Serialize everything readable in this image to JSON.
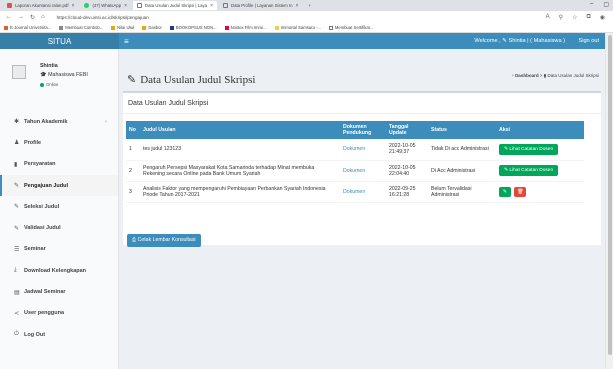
{
  "browser": {
    "tabs": [
      {
        "label": "Laporan Akuntansi ralan.pdf",
        "color": "#d9534f"
      },
      {
        "label": "(47) WhatsApp",
        "color": "#25d366"
      },
      {
        "label": "Data Usulan Judul Skripsi | Laya",
        "color": "#3c8dbc"
      },
      {
        "label": "Data Profile | Layanan Sistem In",
        "color": "#3c8dbc"
      }
    ],
    "new_tab": "+",
    "url": "https://cloud-dev.uinsi.ac.id/skripsi/pengajuan",
    "bookmarks": [
      "E-Journal Universita...",
      "Membuat Combob...",
      "Nilai Ulwi",
      "Dasbor",
      "BOOKOPSUS NON...",
      "Nostex Film Imroi...",
      "Immortal Samsara -...",
      "Membuat Sertifikat..."
    ]
  },
  "brand": "SITUA",
  "topnav": {
    "welcome": "Welcome , ✎ Shintia | ( Mahasiswa )",
    "signout": "Sign out"
  },
  "user": {
    "name": "Shintia",
    "role": "Mahasiswa FEBI",
    "status": "Online"
  },
  "menu": [
    {
      "label": "Tahun Akademik",
      "icon": "✱"
    },
    {
      "label": "Profile",
      "icon": "♟"
    },
    {
      "label": "Persyaratan",
      "icon": "▮"
    },
    {
      "label": "Pengajuan Judul",
      "icon": "✎"
    },
    {
      "label": "Seleksi Judul",
      "icon": "✎"
    },
    {
      "label": "Validasi Judul",
      "icon": "✎"
    },
    {
      "label": "Seminar",
      "icon": "☰"
    },
    {
      "label": "Download Kelengkapan",
      "icon": "⤓"
    },
    {
      "label": "Jadwal Seminar",
      "icon": "▤"
    },
    {
      "label": "User pengguna",
      "icon": "≺"
    },
    {
      "label": "Log Out",
      "icon": "⏻"
    }
  ],
  "page": {
    "title": "Data Usulan Judul Skripsi",
    "breadcrumb_home": "Dashboard",
    "breadcrumb_current": "Data Usulan Judul Skripsi",
    "box_title": "Data Usulan Judul Skripsi",
    "print_button": "Cetak Lembar Konsultasi"
  },
  "table": {
    "headers": {
      "no": "No",
      "judul": "Judul Usulan",
      "dokumen": "Dokumen Pendukung",
      "tanggal": "Tanggal Update",
      "status": "Status",
      "aksi": "Aksi"
    },
    "rows": [
      {
        "no": "1",
        "judul": "tes judul 123123",
        "dokumen": "Dokumen",
        "tanggal": "2022-10-05 21:49:37",
        "status": "Tidak Di acc Administrasi",
        "action": "Lihat Catatan Dosen"
      },
      {
        "no": "2",
        "judul": "Pengaruh Persepsi Masyarakat Kota Samarinda terhadap Minat membuka Rekening secara Online pada Bank Umum Syariah",
        "dokumen": "Dokumen",
        "tanggal": "2022-10-05 22:04:40",
        "status": "Di Acc Administrasi",
        "action": "Lihat Catatan Dosen"
      },
      {
        "no": "3",
        "judul": "Analisis Faktor yang mempengaruhi Pembiayaan Perbankan Syariah Indonesia Priode Tahun 2017-2021",
        "dokumen": "Dokumen",
        "tanggal": "2022-09-25 16:21:28",
        "status": "Belum Tervalidasi Administrasi",
        "action": ""
      }
    ]
  },
  "colors": {
    "primary": "#3c8dbc",
    "success": "#00a65a",
    "danger": "#dd4b39"
  }
}
